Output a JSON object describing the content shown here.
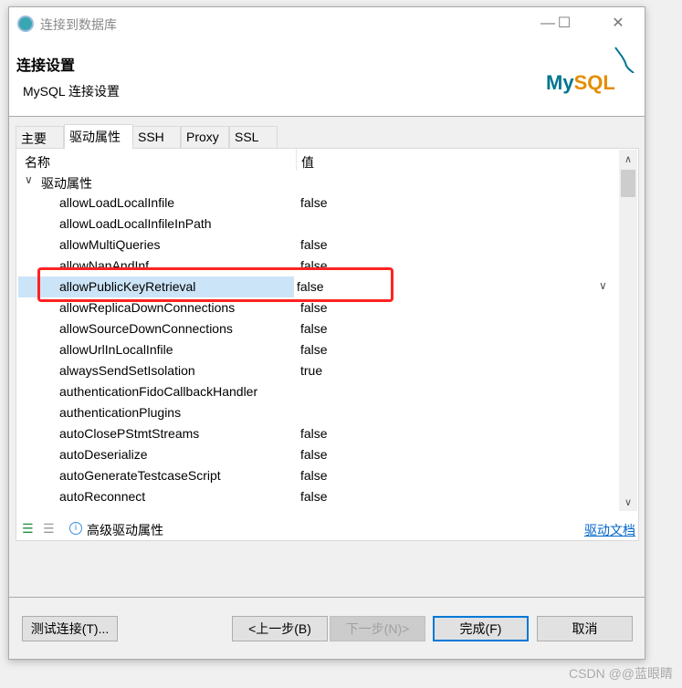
{
  "window": {
    "title": "连接到数据库",
    "minimize": "—",
    "maximize": "☐",
    "close": "✕"
  },
  "header": {
    "title": "连接设置",
    "subtitle": "MySQL 连接设置",
    "logo_text": "MySQL"
  },
  "tabs": [
    {
      "label": "主要"
    },
    {
      "label": "驱动属性",
      "active": true
    },
    {
      "label": "SSH"
    },
    {
      "label": "Proxy"
    },
    {
      "label": "SSL"
    }
  ],
  "table": {
    "columns": [
      "名称",
      "值"
    ],
    "group": "驱动属性",
    "rows": [
      {
        "name": "allowLoadLocalInfile",
        "value": "false"
      },
      {
        "name": "allowLoadLocalInfileInPath",
        "value": ""
      },
      {
        "name": "allowMultiQueries",
        "value": "false"
      },
      {
        "name": "allowNanAndInf",
        "value": "false"
      },
      {
        "name": "allowPublicKeyRetrieval",
        "value": "false",
        "selected": true
      },
      {
        "name": "allowReplicaDownConnections",
        "value": "false"
      },
      {
        "name": "allowSourceDownConnections",
        "value": "false"
      },
      {
        "name": "allowUrlInLocalInfile",
        "value": "false"
      },
      {
        "name": "alwaysSendSetIsolation",
        "value": "true"
      },
      {
        "name": "authenticationFidoCallbackHandler",
        "value": ""
      },
      {
        "name": "authenticationPlugins",
        "value": ""
      },
      {
        "name": "autoClosePStmtStreams",
        "value": "false"
      },
      {
        "name": "autoDeserialize",
        "value": "false"
      },
      {
        "name": "autoGenerateTestcaseScript",
        "value": "false"
      },
      {
        "name": "autoReconnect",
        "value": "false"
      }
    ]
  },
  "bottom": {
    "advanced": "高级驱动属性",
    "docs_link": "驱动文档"
  },
  "buttons": {
    "test": "测试连接(T)...",
    "back": "<上一步(B)",
    "next": "下一步(N)>",
    "finish": "完成(F)",
    "cancel": "取消"
  },
  "watermark": "CSDN @@蓝眼睛",
  "colors": {
    "selection": "#cce4f7",
    "highlight_box": "#ff2222",
    "link": "#0066cc",
    "default_button_border": "#0078d7"
  }
}
